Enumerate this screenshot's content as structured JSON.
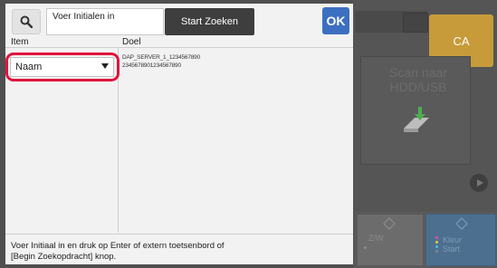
{
  "dialog": {
    "search_placeholder": "Voer Initialen in",
    "start_button": "Start Zoeken",
    "ok_button": "OK",
    "headers": {
      "item": "Item",
      "doel": "Doel"
    },
    "dropdown_value": "Naam",
    "doel_line1": "DAP_SERVER_1_1234567890",
    "doel_line2": "2345678901234567890",
    "hint": "Voer Initiaal in en druk op Enter of extern toetsenbord of [Begin Zoekopdracht] knop."
  },
  "background": {
    "ca_button": "CA",
    "scan_tile": "Scan naar HDD/USB",
    "bw_start_label": "Z/W",
    "color_start_line1": "Kleur",
    "color_start_line2": "Start"
  },
  "colors": {
    "ok_blue": "#3c6fc0",
    "highlight_red": "#e0143c",
    "ca_gold": "#c79b3a"
  },
  "icons": [
    "search-icon",
    "chevron-down-icon",
    "scan-to-hdd-icon",
    "diamond-start-icon"
  ]
}
